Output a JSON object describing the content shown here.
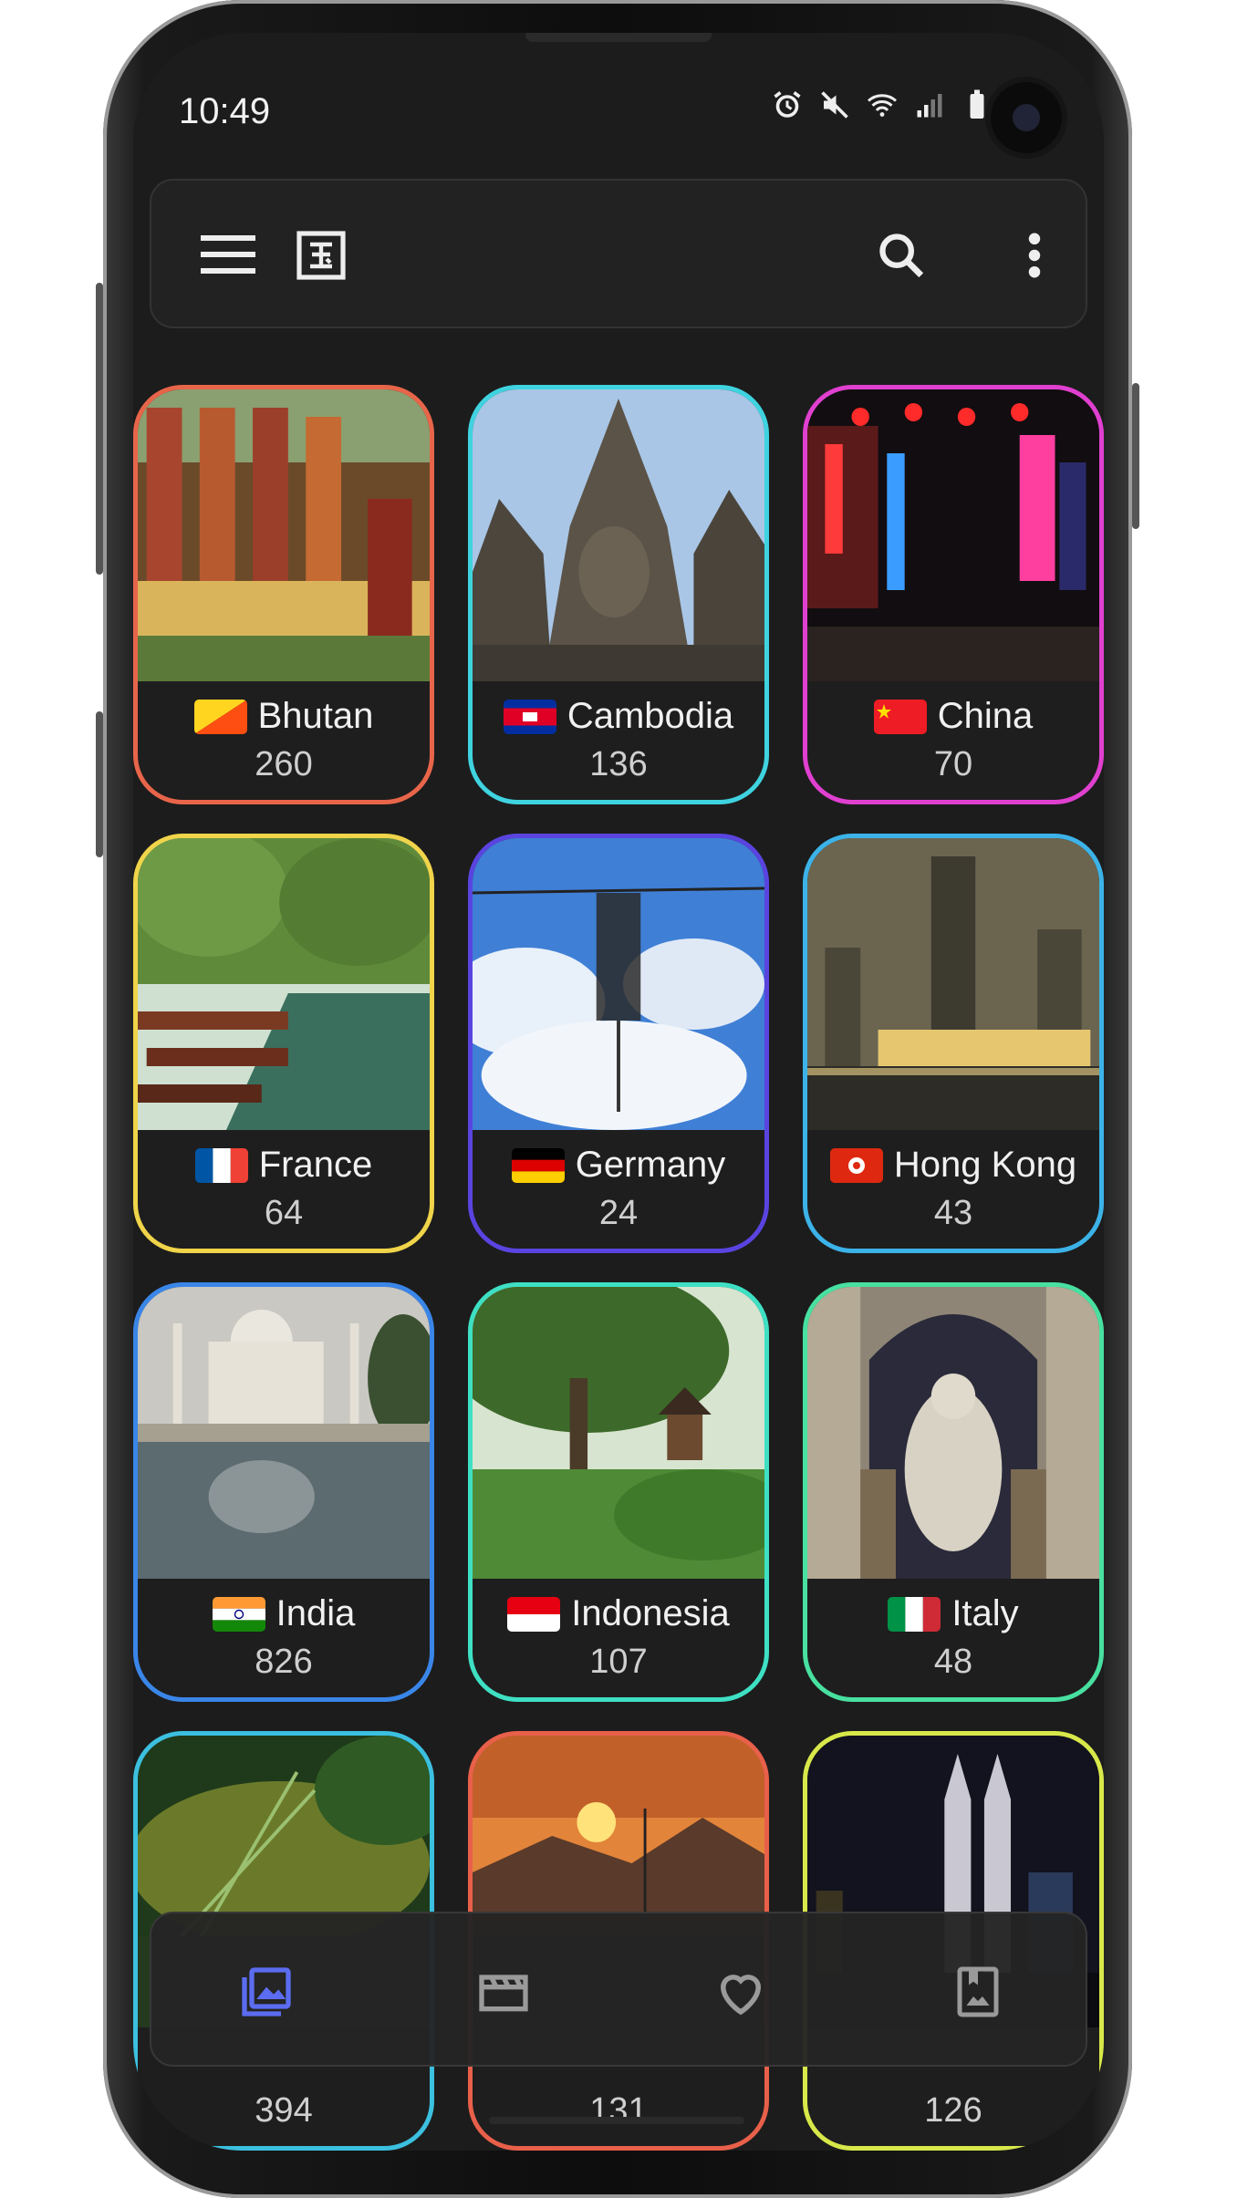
{
  "status": {
    "time": "10:49"
  },
  "toolbar": {
    "menu_icon": "menu-icon",
    "logo_icon": "country-logo-icon",
    "search_icon": "search-icon",
    "more_icon": "more-vert-icon"
  },
  "countries": [
    {
      "name": "Bhutan",
      "count": "260",
      "border": "#e8654a"
    },
    {
      "name": "Cambodia",
      "count": "136",
      "border": "#3fd3e0"
    },
    {
      "name": "China",
      "count": "70",
      "border": "#e040d0"
    },
    {
      "name": "France",
      "count": "64",
      "border": "#f0d44a"
    },
    {
      "name": "Germany",
      "count": "24",
      "border": "#5a44e0"
    },
    {
      "name": "Hong Kong",
      "count": "43",
      "border": "#3cb3e8"
    },
    {
      "name": "India",
      "count": "826",
      "border": "#3a86e8"
    },
    {
      "name": "Indonesia",
      "count": "107",
      "border": "#3ee0c4"
    },
    {
      "name": "Italy",
      "count": "48",
      "border": "#48e0a0"
    },
    {
      "name": "",
      "count": "394",
      "border": "#3cc0e0"
    },
    {
      "name": "",
      "count": "131",
      "border": "#e8604a"
    },
    {
      "name": "",
      "count": "126",
      "border": "#d8e84a"
    }
  ],
  "bottom_nav": [
    {
      "icon": "photos-icon",
      "active": true,
      "color": "#5b6cf0"
    },
    {
      "icon": "video-icon",
      "active": false,
      "color": "#9a9a9a"
    },
    {
      "icon": "favorite-icon",
      "active": false,
      "color": "#9a9a9a"
    },
    {
      "icon": "bookmark-icon",
      "active": false,
      "color": "#9a9a9a"
    }
  ]
}
